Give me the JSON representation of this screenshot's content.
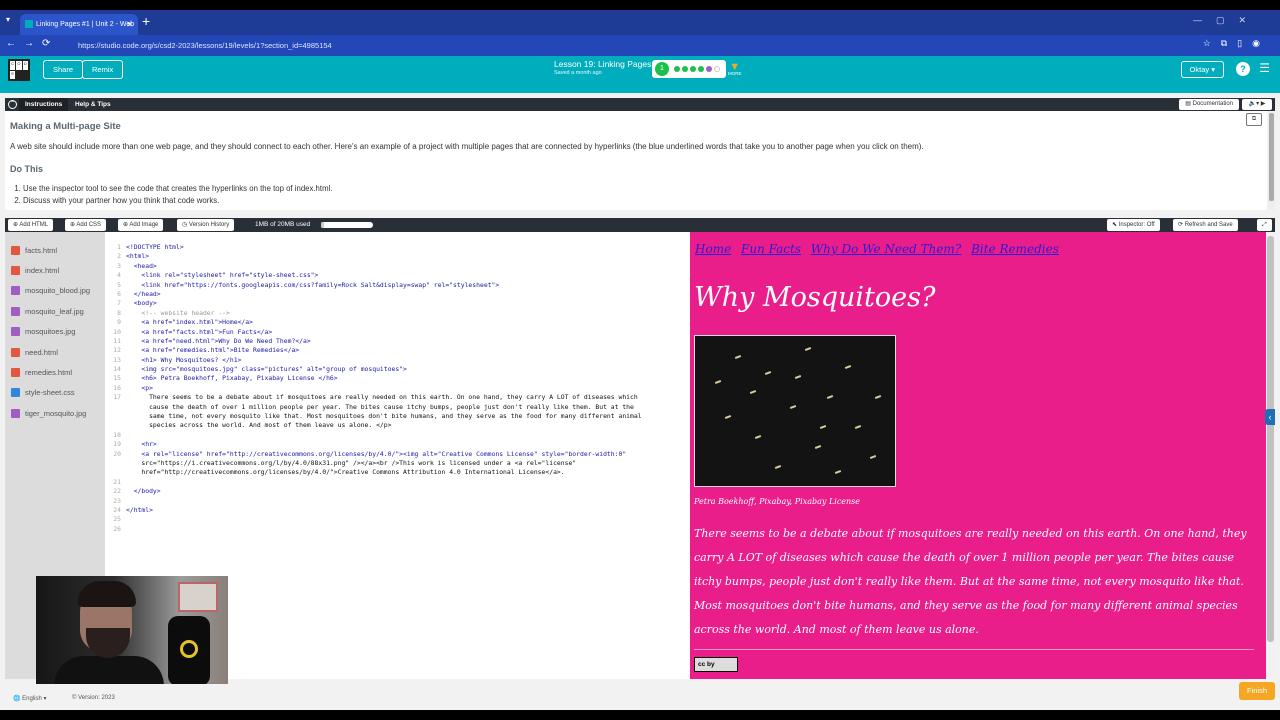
{
  "browser": {
    "tab_title": "Linking Pages #1 | Unit 2 - Web",
    "url": "https://studio.code.org/s/csd2-2023/lessons/19/levels/1?section_id=4985154"
  },
  "header": {
    "logo_letters": [
      "C",
      "O",
      "D",
      "E"
    ],
    "share_label": "Share",
    "remix_label": "Remix",
    "lesson_title": "Lesson 19: Linking Pages",
    "saved_text": "Saved a month ago",
    "progress_current": "1",
    "more_label": "MORE",
    "user_label": "Oktay",
    "help_label": "?"
  },
  "instructions": {
    "tab_instructions": "Instructions",
    "tab_help": "Help & Tips",
    "documentation_label": "Documentation",
    "heading": "Making a Multi-page Site",
    "body": "A web site should include more than one web page, and they should connect to each other. Here's an example of a project with multiple pages that are connected by hyperlinks (the blue underlined words that take you to another page when you click on them).",
    "do_this": "Do This",
    "steps": [
      "Use the inspector tool to see the code that creates the hyperlinks on the top of index.html.",
      "Discuss with your partner how you think that code works."
    ]
  },
  "toolbar": {
    "add_html": "Add HTML",
    "add_css": "Add CSS",
    "add_image": "Add Image",
    "version_history": "Version History",
    "storage_used": "1MB of 20MB used",
    "storage_fraction": 0.05,
    "inspector": "Inspector: Off",
    "refresh_save": "Refresh and Save"
  },
  "files": [
    {
      "name": "facts.html",
      "type": "html"
    },
    {
      "name": "index.html",
      "type": "html"
    },
    {
      "name": "mosquito_blood.jpg",
      "type": "img"
    },
    {
      "name": "mosquito_leaf.jpg",
      "type": "img"
    },
    {
      "name": "mosquitoes.jpg",
      "type": "img"
    },
    {
      "name": "need.html",
      "type": "html"
    },
    {
      "name": "remedies.html",
      "type": "html"
    },
    {
      "name": "style-sheet.css",
      "type": "css"
    },
    {
      "name": "tiger_mosquito.jpg",
      "type": "img"
    }
  ],
  "code_lines": [
    "<!DOCTYPE html>",
    "<html>",
    "  <head>",
    "    <link rel=\"stylesheet\" href=\"style-sheet.css\">",
    "    <link href=\"https://fonts.googleapis.com/css?family=Rock Salt&display=swap\" rel=\"stylesheet\">",
    "  </head>",
    "  <body>",
    "    <!-- website header -->",
    "    <a href=\"index.html\">Home</a>",
    "    <a href=\"facts.html\">Fun Facts</a>",
    "    <a href=\"need.html\">Why Do We Need Them?</a>",
    "    <a href=\"remedies.html\">Bite Remedies</a>",
    "    <h1> Why Mosquitoes? </h1>",
    "    <img src=\"mosquitoes.jpg\" class=\"pictures\" alt=\"group of mosquitoes\">",
    "    <h6> Petra Boekhoff, Pixabay, Pixabay License </h6>",
    "    <p>",
    "      There seems to be a debate about if mosquitoes are really needed on this earth. On one hand, they carry A LOT of diseases which",
    "      cause the death of over 1 million people per year. The bites cause itchy bumps, people just don't really like them. But at the",
    "      same time, not every mosquito like that. Most mosquitoes don't bite humans, and they serve as the food for many different animal",
    "      species across the world. And most of them leave us alone. </p>",
    "",
    "    <hr>",
    "    <a rel=\"license\" href=\"http://creativecommons.org/licenses/by/4.0/\"><img alt=\"Creative Commons License\" style=\"border-width:0\"",
    "    src=\"https://i.creativecommons.org/l/by/4.0/88x31.png\" /></a><br />This work is licensed under a <a rel=\"license\"",
    "    href=\"http://creativecommons.org/licenses/by/4.0/\">Creative Commons Attribution 4.0 International License</a>.",
    "",
    "  </body>",
    "",
    "</html>",
    "",
    ""
  ],
  "line_numbers": [
    "1",
    "2",
    "3",
    "4",
    "5",
    "6",
    "7",
    "8",
    "9",
    "10",
    "11",
    "12",
    "13",
    "14",
    "15",
    "16",
    "17",
    "",
    "",
    "",
    "18",
    "19",
    "20",
    "",
    "",
    "21",
    "22",
    "23",
    "24",
    "25",
    "26"
  ],
  "preview": {
    "nav": [
      "Home",
      "Fun Facts",
      "Why Do We Need Them?",
      "Bite Remedies"
    ],
    "title": "Why Mosquitoes?",
    "image_alt": "group of mosquitoes",
    "caption": "Petra Boekhoff, Pixabay, Pixabay License",
    "text": "There seems to be a debate about if mosquitoes are really needed on this earth. On one hand, they carry A LOT of diseases which cause the death of over 1 million people per year. The bites cause itchy bumps, people just don't really like them. But at the same time, not every mosquito like that. Most mosquitoes don't bite humans, and they serve as the food for many different animal species across the world. And most of them leave us alone.",
    "license_badge": "cc by"
  },
  "footer": {
    "language": "English",
    "version": "Version: 2023",
    "finish": "Finish"
  },
  "colors": {
    "brand_teal": "#00adbc",
    "preview_pink": "#ea1e8a",
    "link_blue": "#2b1ad6",
    "finish_orange": "#f5a623"
  }
}
